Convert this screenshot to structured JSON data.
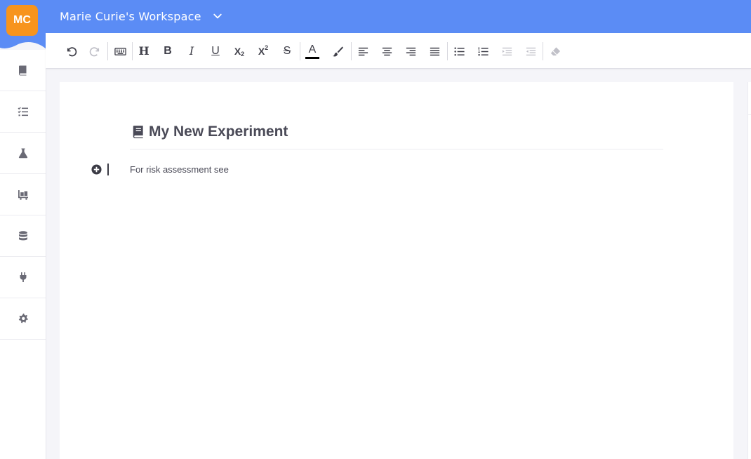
{
  "header": {
    "workspace_title": "Marie Curie's Workspace",
    "avatar_initials": "MC",
    "brand_color": "#5b8cf5",
    "avatar_color": "#f7941d"
  },
  "sidebar": {
    "items": [
      {
        "icon": "book-icon"
      },
      {
        "icon": "checklist-icon"
      },
      {
        "icon": "flask-icon"
      },
      {
        "icon": "inventory-cart-icon"
      },
      {
        "icon": "database-icon"
      },
      {
        "icon": "plug-icon"
      },
      {
        "icon": "gear-icon"
      }
    ]
  },
  "toolbar": {
    "heading_label": "H",
    "bold_label": "B",
    "italic_label": "I",
    "underline_label": "U",
    "subscript_label": "X",
    "subscript_sub": "2",
    "superscript_label": "X",
    "superscript_sup": "2",
    "strike_label": "S",
    "font_color_label": "A",
    "font_color": "#000000"
  },
  "editor": {
    "title": "My New Experiment",
    "paragraph": "For risk assessment see"
  }
}
